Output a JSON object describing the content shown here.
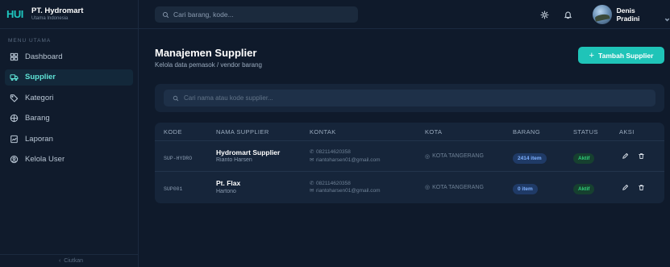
{
  "brand": {
    "logo": "HUI",
    "name": "PT. Hydromart",
    "subtitle": "Utama Indonesia"
  },
  "sidebar": {
    "section_label": "MENU UTAMA",
    "items": [
      {
        "label": "Dashboard",
        "icon": "grid-icon",
        "active": false
      },
      {
        "label": "Supplier",
        "icon": "truck-icon",
        "active": true
      },
      {
        "label": "Kategori",
        "icon": "tag-icon",
        "active": false
      },
      {
        "label": "Barang",
        "icon": "box-icon",
        "active": false
      },
      {
        "label": "Laporan",
        "icon": "report-icon",
        "active": false
      },
      {
        "label": "Kelola User",
        "icon": "users-icon",
        "active": false
      }
    ],
    "collapse_label": "Ciutkan"
  },
  "topbar": {
    "search_placeholder": "Cari barang, kode...",
    "user_name": "Denis Pradini"
  },
  "page": {
    "title": "Manajemen Supplier",
    "subtitle": "Kelola data pemasok / vendor barang",
    "add_button": "Tambah Supplier",
    "search_placeholder": "Cari nama atau kode supplier..."
  },
  "table": {
    "headers": {
      "kode": "KODE",
      "nama": "NAMA SUPPLIER",
      "kontak": "KONTAK",
      "kota": "KOTA",
      "barang": "BARANG",
      "status": "STATUS",
      "aksi": "AKSI"
    },
    "rows": [
      {
        "kode": "SUP-HYDRO",
        "nama": "Hydromart Supplier",
        "pic": "Rianto Harsen",
        "phone": "082114620358",
        "email": "riantoharsen01@gmail.com",
        "kota": "KOTA TANGERANG",
        "barang": "2414 item",
        "status": "Aktif"
      },
      {
        "kode": "SUP001",
        "nama": "Pt. Flax",
        "pic": "Hartono",
        "phone": "082114620358",
        "email": "riantoharsen01@gmail.com",
        "kota": "KOTA TANGERANG",
        "barang": "0 item",
        "status": "Aktif"
      }
    ]
  },
  "colors": {
    "accent": "#1fc4b8",
    "background": "#0f1a2b",
    "card": "#16253a",
    "status_active": "#2fd07a",
    "badge_item": "#7fb1ff"
  }
}
